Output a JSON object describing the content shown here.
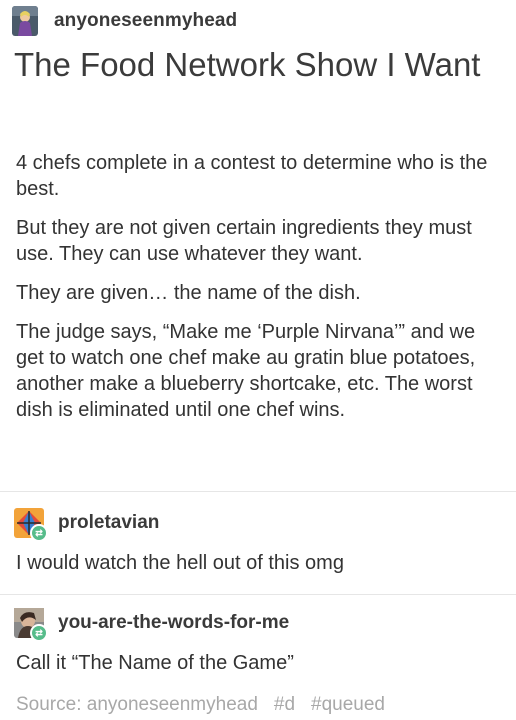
{
  "post": {
    "username": "anyoneseenmyhead",
    "title": "The Food Network Show I Want",
    "paragraphs": [
      "4 chefs complete in a contest to determine who is the best.",
      "But they are not given certain ingredients they must use. They can use whatever they want.",
      "They are given… the name of the dish.",
      "The judge says, “Make me ‘Purple Nirvana’” and we get to watch one chef make au gratin blue potatoes, another make a blueberry shortcake, etc. The worst dish is eliminated until one chef wins."
    ]
  },
  "reblogs": [
    {
      "username": "proletavian",
      "text": "I would watch the hell out of this omg"
    },
    {
      "username": "you-are-the-words-for-me",
      "text": "Call it “The Name of the Game”"
    }
  ],
  "footer": {
    "source": "Source: anyoneseenmyhead",
    "tags": [
      "#d",
      "#queued"
    ]
  },
  "colors": {
    "badge": "#56bc8a",
    "footer_text": "#a8a8a8"
  },
  "icons": {
    "reblog_badge": "reblog-icon"
  }
}
